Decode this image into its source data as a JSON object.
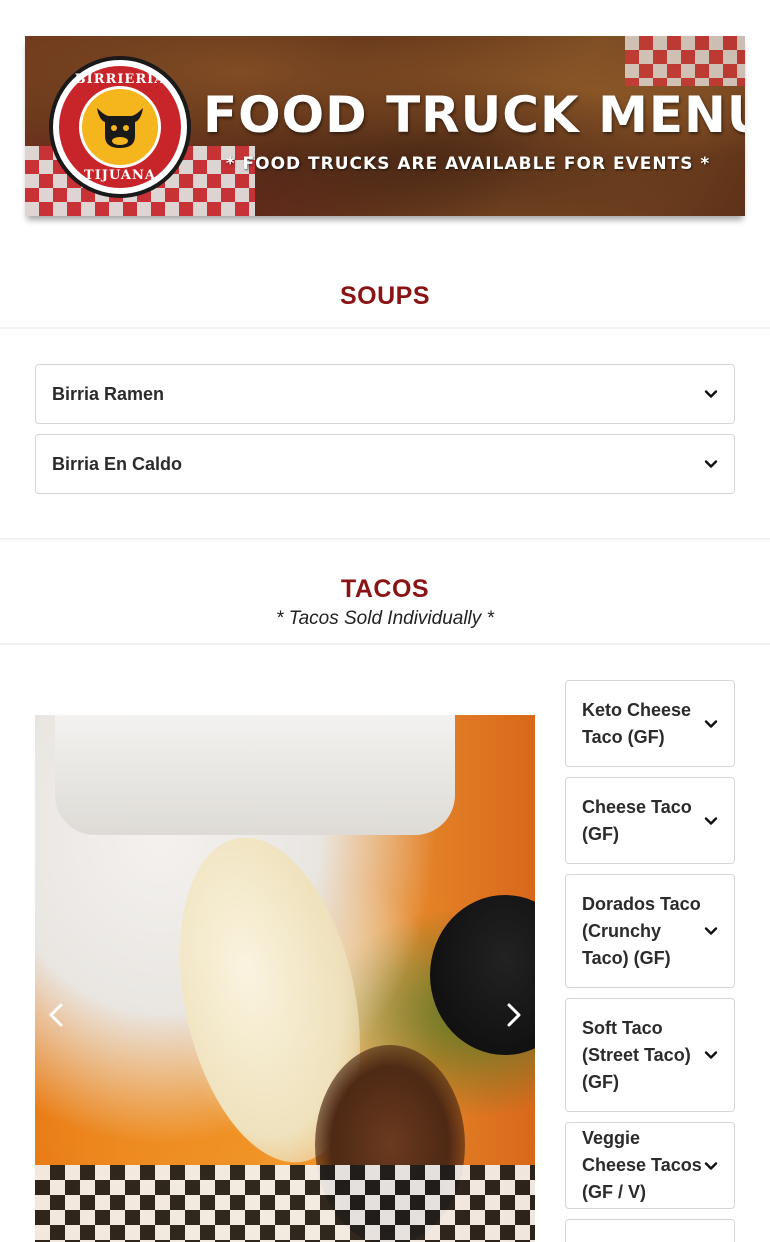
{
  "banner": {
    "logo_top": "BIRRIERIA",
    "logo_bottom": "TIJUANA",
    "title": "FOOD TRUCK MENU",
    "subtitle": "* FOOD TRUCKS ARE AVAILABLE FOR EVENTS *"
  },
  "soups": {
    "title": "SOUPS",
    "items": [
      {
        "label": "Birria Ramen"
      },
      {
        "label": "Birria En Caldo"
      }
    ]
  },
  "tacos": {
    "title": "TACOS",
    "subtitle": "* Tacos Sold Individually *",
    "items": [
      {
        "label": "Keto Cheese Taco (GF)"
      },
      {
        "label": "Cheese Taco (GF)"
      },
      {
        "label": "Dorados Taco (Crunchy Taco) (GF)"
      },
      {
        "label": "Soft Taco (Street Taco) (GF)"
      },
      {
        "label": "Veggie Cheese Tacos (GF / V)"
      }
    ]
  },
  "colors": {
    "section_title": "#8b1313",
    "text": "#2b2b2b",
    "border": "#d6d6d6"
  }
}
